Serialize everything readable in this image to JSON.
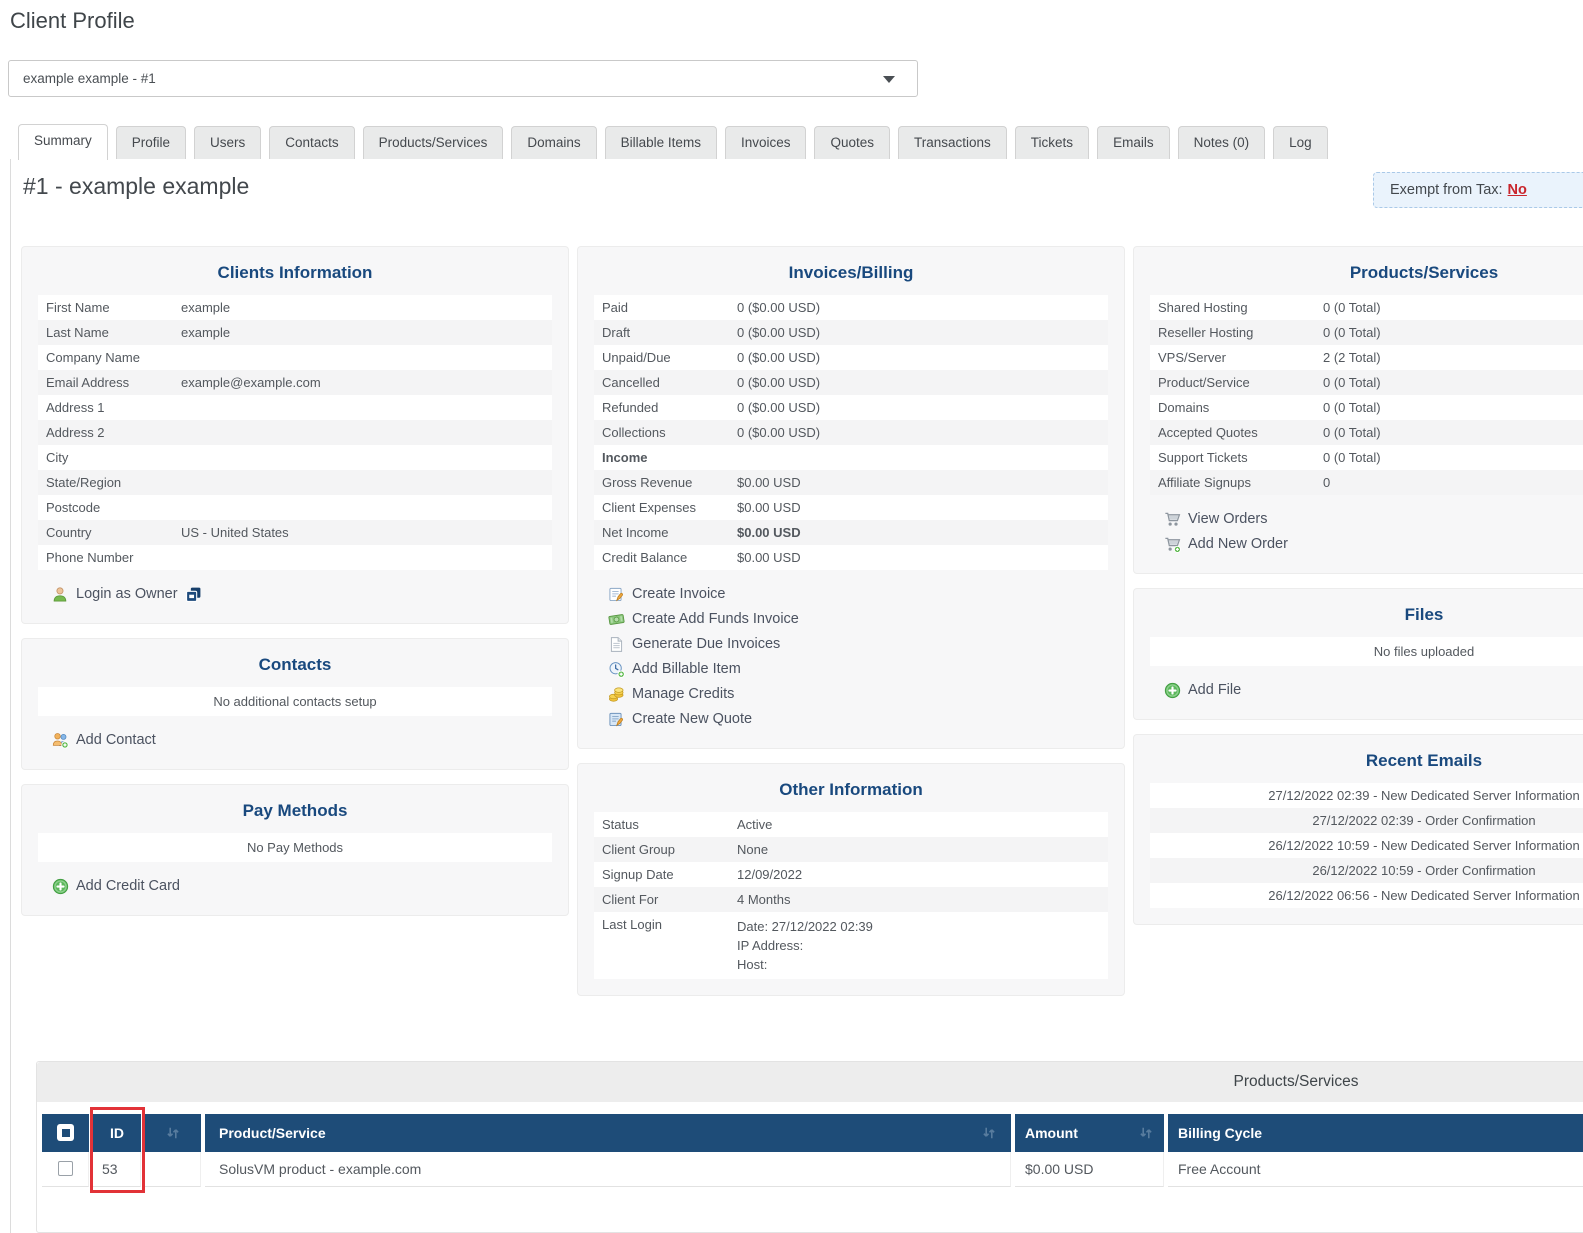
{
  "page": {
    "title": "Client Profile"
  },
  "client_selector": {
    "value": "example example - #1"
  },
  "tabs": [
    {
      "label": "Summary",
      "active": true
    },
    {
      "label": "Profile"
    },
    {
      "label": "Users"
    },
    {
      "label": "Contacts"
    },
    {
      "label": "Products/Services"
    },
    {
      "label": "Domains"
    },
    {
      "label": "Billable Items"
    },
    {
      "label": "Invoices"
    },
    {
      "label": "Quotes"
    },
    {
      "label": "Transactions"
    },
    {
      "label": "Tickets"
    },
    {
      "label": "Emails"
    },
    {
      "label": "Notes (0)"
    },
    {
      "label": "Log"
    }
  ],
  "header": {
    "title": "#1 - example example",
    "exempt_label": "Exempt from Tax:",
    "exempt_value": "No"
  },
  "panels": {
    "clients_information": {
      "title": "Clients Information",
      "rows": [
        {
          "label": "First Name",
          "value": "example"
        },
        {
          "label": "Last Name",
          "value": "example"
        },
        {
          "label": "Company Name",
          "value": ""
        },
        {
          "label": "Email Address",
          "value": "example@example.com"
        },
        {
          "label": "Address 1",
          "value": ""
        },
        {
          "label": "Address 2",
          "value": ""
        },
        {
          "label": "City",
          "value": ""
        },
        {
          "label": "State/Region",
          "value": ""
        },
        {
          "label": "Postcode",
          "value": ""
        },
        {
          "label": "Country",
          "value": "US - United States"
        },
        {
          "label": "Phone Number",
          "value": ""
        }
      ],
      "actions": [
        {
          "label": "Login as Owner",
          "icon": "person-icon",
          "trail_icon": "login-window-icon"
        }
      ]
    },
    "contacts": {
      "title": "Contacts",
      "empty": "No additional contacts setup",
      "actions": [
        {
          "label": "Add Contact",
          "icon": "add-contact-icon"
        }
      ]
    },
    "pay_methods": {
      "title": "Pay Methods",
      "empty": "No Pay Methods",
      "actions": [
        {
          "label": "Add Credit Card",
          "icon": "plus-circle-icon"
        }
      ]
    },
    "invoices_billing": {
      "title": "Invoices/Billing",
      "rows": [
        {
          "label": "Paid",
          "value": "0 ($0.00 USD)"
        },
        {
          "label": "Draft",
          "value": "0 ($0.00 USD)"
        },
        {
          "label": "Unpaid/Due",
          "value": "0 ($0.00 USD)"
        },
        {
          "label": "Cancelled",
          "value": "0 ($0.00 USD)"
        },
        {
          "label": "Refunded",
          "value": "0 ($0.00 USD)"
        },
        {
          "label": "Collections",
          "value": "0 ($0.00 USD)"
        },
        {
          "label": "Income",
          "value": "",
          "label_bold": true
        },
        {
          "label": "Gross Revenue",
          "value": "$0.00 USD"
        },
        {
          "label": "Client Expenses",
          "value": "$0.00 USD"
        },
        {
          "label": "Net Income",
          "value": "$0.00 USD",
          "value_bold": true
        },
        {
          "label": "Credit Balance",
          "value": "$0.00 USD"
        }
      ],
      "actions": [
        {
          "label": "Create Invoice",
          "icon": "invoice-edit-icon"
        },
        {
          "label": "Create Add Funds Invoice",
          "icon": "money-icon"
        },
        {
          "label": "Generate Due Invoices",
          "icon": "page-icon"
        },
        {
          "label": "Add Billable Item",
          "icon": "billable-item-icon"
        },
        {
          "label": "Manage Credits",
          "icon": "coins-icon"
        },
        {
          "label": "Create New Quote",
          "icon": "quote-edit-icon"
        }
      ]
    },
    "other_information": {
      "title": "Other Information",
      "rows": [
        {
          "label": "Status",
          "value": "Active"
        },
        {
          "label": "Client Group",
          "value": "None"
        },
        {
          "label": "Signup Date",
          "value": "12/09/2022"
        },
        {
          "label": "Client For",
          "value": "4 Months"
        },
        {
          "label": "Last Login",
          "lines": [
            "Date: 27/12/2022 02:39",
            "IP Address:",
            "Host:"
          ]
        }
      ]
    },
    "products_services": {
      "title": "Products/Services",
      "rows": [
        {
          "label": "Shared Hosting",
          "value": "0 (0 Total)"
        },
        {
          "label": "Reseller Hosting",
          "value": "0 (0 Total)"
        },
        {
          "label": "VPS/Server",
          "value": "2 (2 Total)"
        },
        {
          "label": "Product/Service",
          "value": "0 (0 Total)"
        },
        {
          "label": "Domains",
          "value": "0 (0 Total)"
        },
        {
          "label": "Accepted Quotes",
          "value": "0 (0 Total)"
        },
        {
          "label": "Support Tickets",
          "value": "0 (0 Total)"
        },
        {
          "label": "Affiliate Signups",
          "value": "0"
        }
      ],
      "actions": [
        {
          "label": "View Orders",
          "icon": "cart-icon"
        },
        {
          "label": "Add New Order",
          "icon": "cart-add-icon"
        }
      ]
    },
    "files": {
      "title": "Files",
      "empty": "No files uploaded",
      "actions": [
        {
          "label": "Add File",
          "icon": "plus-circle-icon"
        }
      ]
    },
    "recent_emails": {
      "title": "Recent Emails",
      "items": [
        "27/12/2022 02:39 - New Dedicated Server Information",
        "27/12/2022 02:39 - Order Confirmation",
        "26/12/2022 10:59 - New Dedicated Server Information",
        "26/12/2022 10:59 - Order Confirmation",
        "26/12/2022 06:56 - New Dedicated Server Information"
      ]
    }
  },
  "products_table": {
    "title": "Products/Services",
    "columns": {
      "id": "ID",
      "product": "Product/Service",
      "amount": "Amount",
      "billing": "Billing Cycle"
    },
    "rows": [
      {
        "id": "53",
        "product": "SolusVM product - example.com",
        "amount": "$0.00 USD",
        "billing": "Free Account"
      }
    ]
  },
  "colors": {
    "table_header_navy": "#1e4c78",
    "panel_title_blue": "#19497e",
    "exempt_no_red": "#c9252c",
    "annotation_red": "#e23237",
    "stripe_gray": "#f4f4f5"
  }
}
